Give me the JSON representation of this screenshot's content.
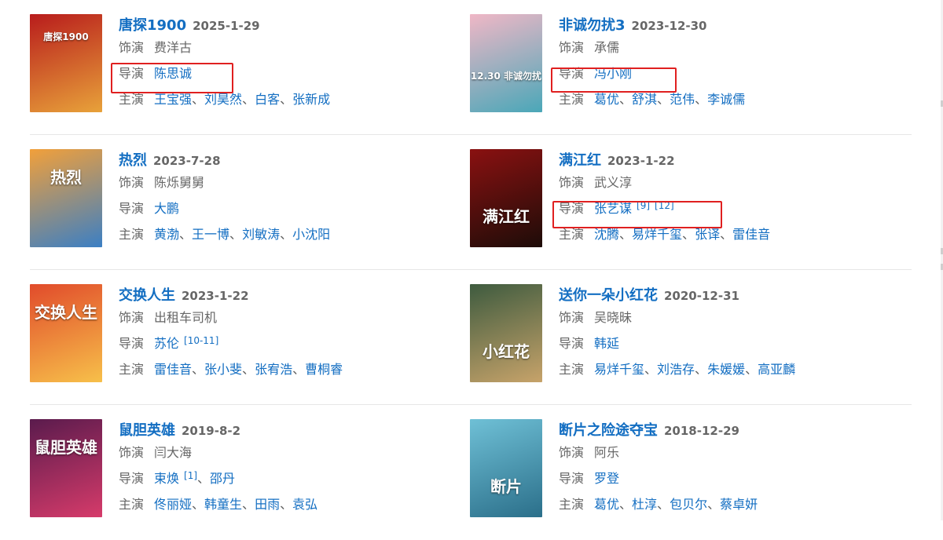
{
  "labels": {
    "role": "饰演",
    "director": "导演",
    "cast": "主演"
  },
  "films": [
    {
      "title": "唐探1900",
      "date": "2025-1-29",
      "role": "费洋古",
      "directors": [
        {
          "name": "陈思诚",
          "ref": ""
        }
      ],
      "cast": [
        "王宝强",
        "刘昊然",
        "白客",
        "张新成"
      ],
      "poster_text": "唐探1900",
      "poster_colors": [
        "#b81c1c",
        "#e8a23a"
      ]
    },
    {
      "title": "非诚勿扰3",
      "date": "2023-12-30",
      "role": "承儒",
      "directors": [
        {
          "name": "冯小刚",
          "ref": ""
        }
      ],
      "cast": [
        "葛优",
        "舒淇",
        "范伟",
        "李诚儒"
      ],
      "poster_text": "12.30 非诚勿扰",
      "poster_colors": [
        "#f0b7c6",
        "#4aa7b8"
      ]
    },
    {
      "title": "热烈",
      "date": "2023-7-28",
      "role": "陈烁舅舅",
      "directors": [
        {
          "name": "大鹏",
          "ref": ""
        }
      ],
      "cast": [
        "黄渤",
        "王一博",
        "刘敏涛",
        "小沈阳"
      ],
      "poster_text": "热烈",
      "poster_colors": [
        "#f2a03a",
        "#3b7fc4"
      ]
    },
    {
      "title": "满江红",
      "date": "2023-1-22",
      "role": "武义淳",
      "directors": [
        {
          "name": "张艺谋",
          "ref": "[9]",
          "ref2": "[12]"
        }
      ],
      "cast": [
        "沈腾",
        "易烊千玺",
        "张译",
        "雷佳音"
      ],
      "poster_text": "满江红",
      "poster_colors": [
        "#8a1111",
        "#1d0c08"
      ]
    },
    {
      "title": "交换人生",
      "date": "2023-1-22",
      "role": "出租车司机",
      "directors": [
        {
          "name": "苏伦",
          "ref": "[10-11]"
        }
      ],
      "cast": [
        "雷佳音",
        "张小斐",
        "张宥浩",
        "曹桐睿"
      ],
      "poster_text": "交换人生",
      "poster_colors": [
        "#e14b2b",
        "#f7c04a"
      ]
    },
    {
      "title": "送你一朵小红花",
      "date": "2020-12-31",
      "role": "吴晓昧",
      "directors": [
        {
          "name": "韩延",
          "ref": ""
        }
      ],
      "cast": [
        "易烊千玺",
        "刘浩存",
        "朱媛媛",
        "高亚麟"
      ],
      "poster_text": "小红花",
      "poster_colors": [
        "#3e5b3f",
        "#c7a36a"
      ]
    },
    {
      "title": "鼠胆英雄",
      "date": "2019-8-2",
      "role": "闫大海",
      "directors": [
        {
          "name": "束焕",
          "ref": "[1]"
        },
        {
          "name": "邵丹",
          "ref": ""
        }
      ],
      "cast": [
        "佟丽娅",
        "韩童生",
        "田雨",
        "袁弘"
      ],
      "poster_text": "鼠胆英雄",
      "poster_colors": [
        "#5a1b4d",
        "#d63b6a"
      ]
    },
    {
      "title": "断片之险途夺宝",
      "date": "2018-12-29",
      "role": "阿乐",
      "directors": [
        {
          "name": "罗登",
          "ref": ""
        }
      ],
      "cast": [
        "葛优",
        "杜淳",
        "包贝尔",
        "蔡卓妍"
      ],
      "poster_text": "断片",
      "poster_colors": [
        "#6fc0d6",
        "#2b6f8a"
      ]
    }
  ]
}
